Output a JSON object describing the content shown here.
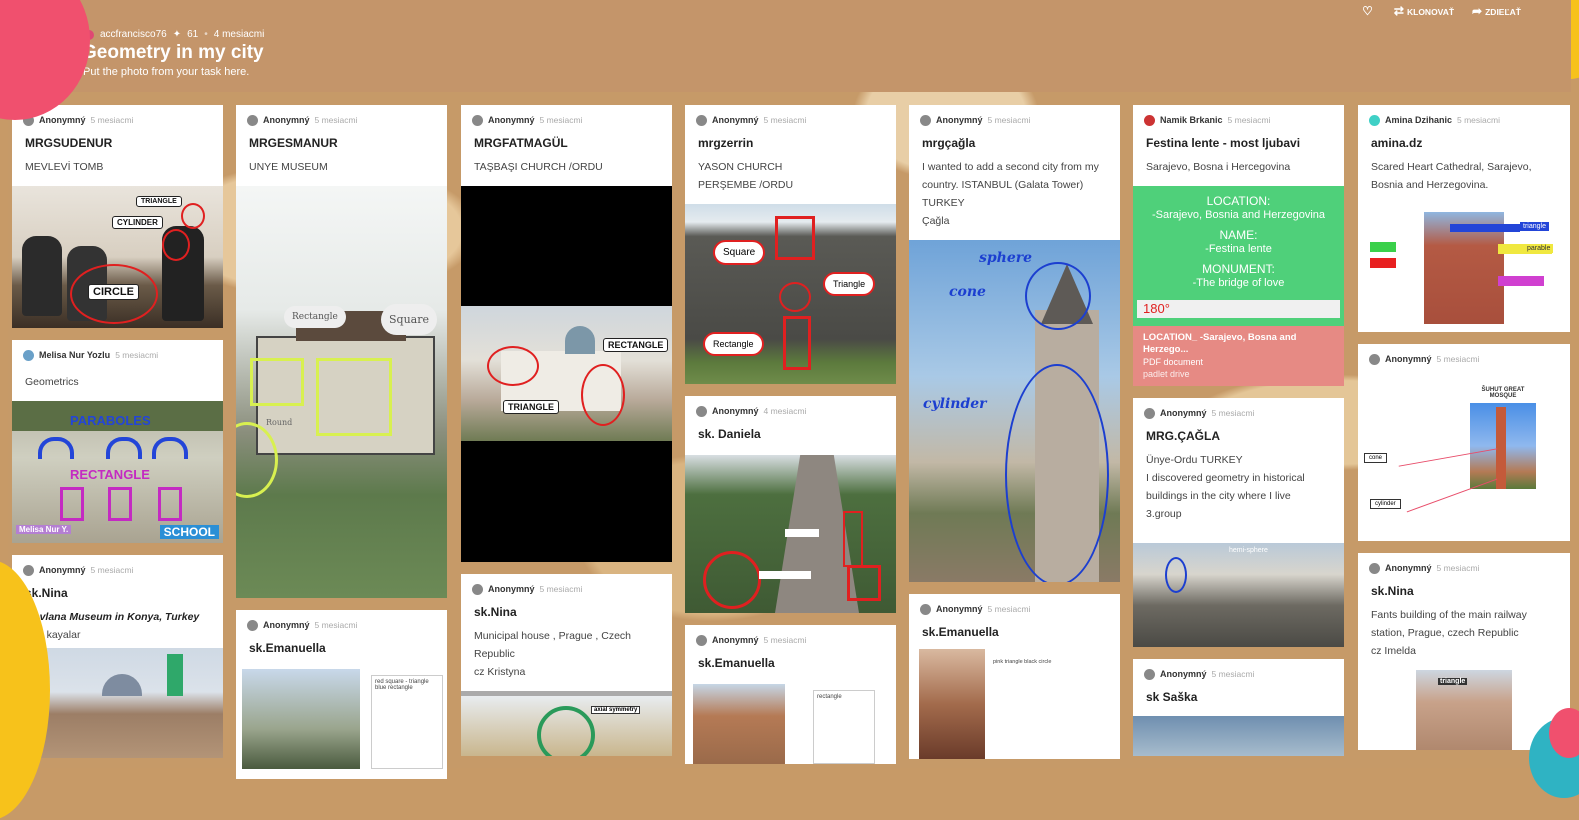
{
  "header": {
    "author": "accfrancisco76",
    "count": "61",
    "time": "4 mesiacmi",
    "title": "Geometry in my city",
    "subtitle": "Put the photo from your task here."
  },
  "actions": {
    "clone": "KLONOVAŤ",
    "share": "ZDIEĽAŤ"
  },
  "posts": {
    "c1a": {
      "author": "Anonymný",
      "ago": "5 mesiacmi",
      "title": "MRGSUDENUR",
      "body": "MEVLEVİ TOMB",
      "labels": [
        "TRIANGLE",
        "CYLINDER",
        "CIRCLE"
      ]
    },
    "c1b": {
      "author": "Melisa Nur Yozlu",
      "ago": "5 mesiacmi",
      "body": "Geometrics",
      "labels": [
        "PARABOLES",
        "RECTANGLE",
        "Melisa Nur Y.",
        "SCHOOL"
      ]
    },
    "c1c": {
      "author": "Anonymný",
      "ago": "5 mesiacmi",
      "title": "sk.Nina",
      "body1": "Mevlana Museum in Konya, Turkey",
      "body2": "halil kayalar"
    },
    "c2a": {
      "author": "Anonymný",
      "ago": "5 mesiacmi",
      "title": "MRGESMANUR",
      "body": "UNYE MUSEUM",
      "labels": [
        "Rectangle",
        "Square",
        "Round"
      ]
    },
    "c2b": {
      "author": "Anonymný",
      "ago": "5 mesiacmi",
      "title": "sk.Emanuella",
      "note": "red square - triangle blue rectangle"
    },
    "c3a": {
      "author": "Anonymný",
      "ago": "5 mesiacmi",
      "title": "MRGFATMAGÜL",
      "body": "TAŞBAŞI CHURCH /ORDU",
      "labels": [
        "RECTANGLE",
        "TRIANGLE"
      ]
    },
    "c3b": {
      "author": "Anonymný",
      "ago": "5 mesiacmi",
      "title": "sk.Nina",
      "body1": "Municipal house , Prague , Czech Republic",
      "body2": "cz Kristyna",
      "imglabel": "axial symmetry"
    },
    "c4a": {
      "author": "Anonymný",
      "ago": "5 mesiacmi",
      "title": "mrgzerrin",
      "body1": "YASON CHURCH",
      "body2": "PERŞEMBE /ORDU",
      "labels": [
        "Square",
        "Triangle",
        "Rectangle"
      ]
    },
    "c4b": {
      "author": "Anonymný",
      "ago": "4 mesiacmi",
      "title": "sk. Daniela"
    },
    "c4c": {
      "author": "Anonymný",
      "ago": "5 mesiacmi",
      "title": "sk.Emanuella",
      "note": "rectangle"
    },
    "c5a": {
      "author": "Anonymný",
      "ago": "5 mesiacmi",
      "title": "mrgçağla",
      "body1": "I wanted to add a second city from my country. ISTANBUL (Galata Tower)",
      "body2": "TURKEY",
      "body3": "Çağla",
      "labels": [
        "sphere",
        "cone",
        "cylinder"
      ]
    },
    "c5b": {
      "author": "Anonymný",
      "ago": "5 mesiacmi",
      "title": "sk.Emanuella",
      "note": "pink triangle black circle"
    },
    "c6a": {
      "author": "Namik Brkanic",
      "ago": "5 mesiacmi",
      "title": "Festina lente - most ljubavi",
      "body": "Sarajevo, Bosna i Hercegovina",
      "green": {
        "h1": "LOCATION:",
        "v1": "-Sarajevo, Bosnia and Herzegovina",
        "h2": "NAME:",
        "v2": "-Festina lente",
        "h3": "MONUMENT:",
        "v3": "-The bridge of love",
        "deg": "180°"
      },
      "pdf": {
        "title": "LOCATION_ -Sarajevo, Bosna and Herzego...",
        "type": "PDF document",
        "src": "padlet drive"
      }
    },
    "c6b": {
      "author": "Anonymný",
      "ago": "5 mesiacmi",
      "title": "MRG.ÇAĞLA",
      "body1": "Ünye-Ordu TURKEY",
      "body2": "I discovered geometry in historical buildings in the city where I live",
      "body3": "3.group",
      "imglabel": "hemi-sphere"
    },
    "c6c": {
      "author": "Anonymný",
      "ago": "5 mesiacmi",
      "title": "sk Saška"
    },
    "c7a": {
      "author": "Amina Dzihanic",
      "ago": "5 mesiacmi",
      "title": "amina.dz",
      "body": "Scared Heart Cathedral, Sarajevo, Bosnia and Herzegovina.",
      "labels": [
        "triangle",
        "parable"
      ]
    },
    "c7b": {
      "author": "Anonymný",
      "ago": "5 mesiacmi",
      "labels": [
        "cone",
        "cylinder"
      ],
      "imgtitle": "ŠUHUT GREAT MOSQUE"
    },
    "c7c": {
      "author": "Anonymný",
      "ago": "5 mesiacmi",
      "title": "sk.Nina",
      "body1": "Fants building of the main railway station, Prague, czech Republic",
      "body2": "cz Imelda",
      "imglabel": "triangle"
    }
  }
}
